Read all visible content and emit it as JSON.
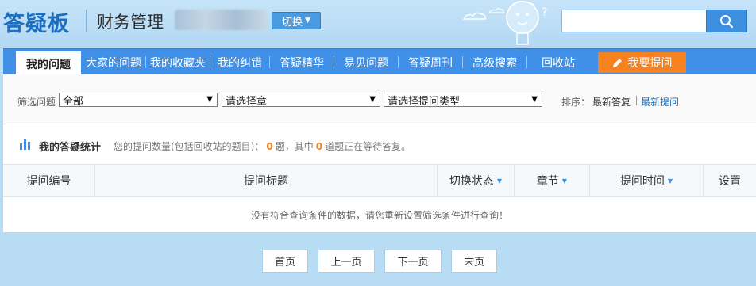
{
  "header": {
    "logo": "答疑板",
    "course_title": "财务管理",
    "switch_label": "切换",
    "search": {
      "value": "",
      "placeholder": ""
    }
  },
  "nav": {
    "items": [
      {
        "label": "我的问题",
        "active": true
      },
      {
        "label": "大家的问题"
      },
      {
        "label": "我的收藏夹"
      },
      {
        "label": "我的纠错"
      },
      {
        "label": "答疑精华"
      },
      {
        "label": "易见问题"
      },
      {
        "label": "答疑周刊"
      },
      {
        "label": "高级搜索"
      },
      {
        "label": "回收站"
      }
    ],
    "ask_label": "我要提问"
  },
  "filter": {
    "label": "筛选问题",
    "selects": [
      {
        "value": "全部"
      },
      {
        "value": "请选择章"
      },
      {
        "value": "请选择提问类型"
      }
    ],
    "sort_label": "排序：",
    "sort_reply": "最新答复",
    "sort_question": "最新提问"
  },
  "stats": {
    "title": "我的答疑统计",
    "prefix": "您的提问数量(包括回收站的题目)：",
    "total": "0",
    "middle": "题，其中",
    "pending": "0",
    "suffix": "道题正在等待答复。"
  },
  "table": {
    "columns": [
      "提问编号",
      "提问标题",
      "切换状态",
      "章节",
      "提问时间",
      "设置"
    ],
    "empty_message": "没有符合查询条件的数据，请您重新设置筛选条件进行查询！"
  },
  "pagination": {
    "first": "首页",
    "prev": "上一页",
    "next": "下一页",
    "last": "末页"
  },
  "colors": {
    "brand": "#1a6fc2",
    "nav_bg": "#3f90e6",
    "accent": "#f5821f",
    "page_bg": "#b9dcf5"
  },
  "icons": [
    "search-icon",
    "pencil-icon",
    "bar-chart-icon",
    "caret-down-icon",
    "mascot-illustration"
  ]
}
